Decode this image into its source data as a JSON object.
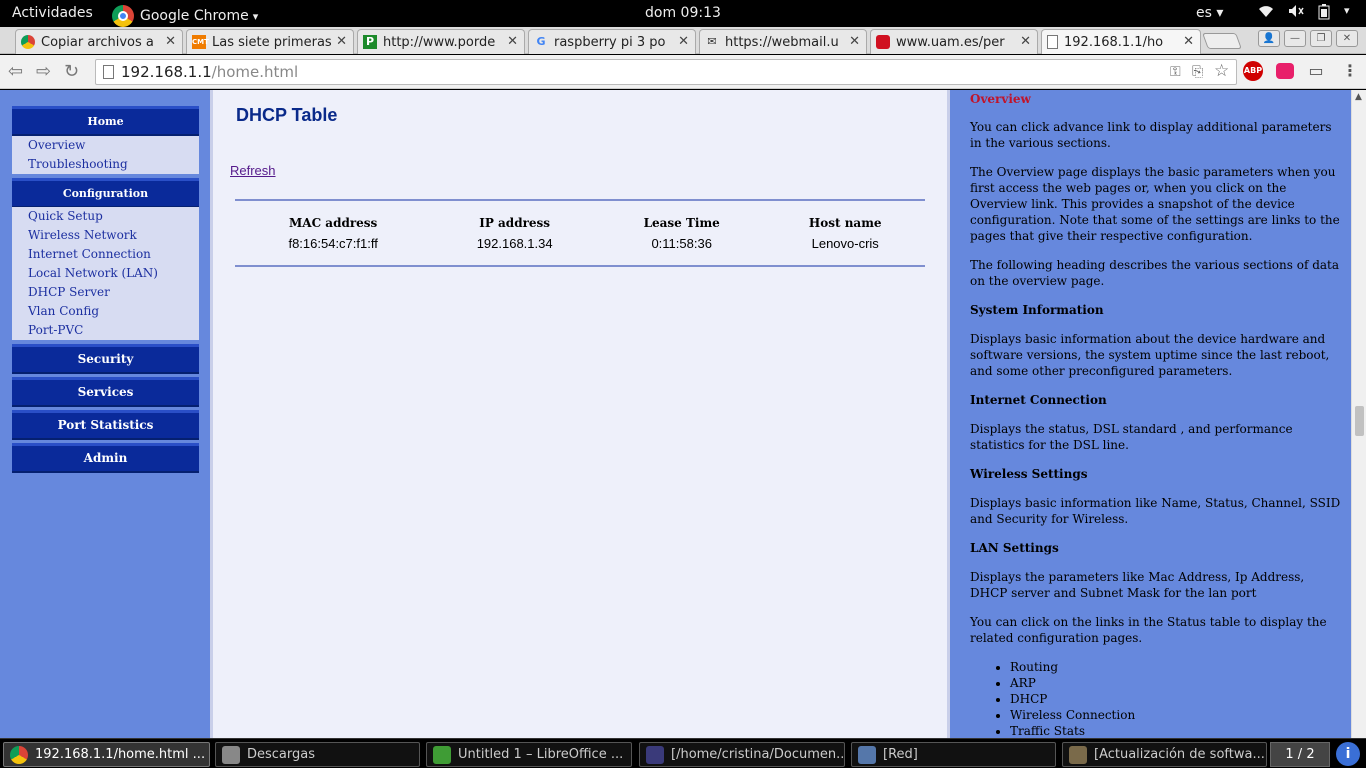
{
  "topbar": {
    "activities": "Actividades",
    "app_name": "Google Chrome",
    "app_menu_arrow": "▾",
    "clock": "dom 09:13",
    "language": "es ▾",
    "wifi_icon": "wifi-icon",
    "volume_icon": "volume-icon",
    "battery_icon": "battery-icon"
  },
  "tabs": [
    {
      "title": "Copiar archivos a",
      "icon": "chrome-icon"
    },
    {
      "title": "Las siete primeras",
      "icon": "cmt-icon"
    },
    {
      "title": "http://www.porde",
      "icon": "p-icon"
    },
    {
      "title": "raspberry pi 3 po",
      "icon": "google-icon"
    },
    {
      "title": "https://webmail.u",
      "icon": "mail-icon"
    },
    {
      "title": "www.uam.es/per",
      "icon": "uam-icon"
    },
    {
      "title": "192.168.1.1/ho",
      "icon": "page-icon",
      "active": true
    }
  ],
  "omnibox": {
    "host": "192.168.1.1",
    "path": "/home.html"
  },
  "extensions": {
    "abp_label": "ABP"
  },
  "nav": {
    "home": "Home",
    "home_items": [
      "Overview",
      "Troubleshooting"
    ],
    "configuration": "Configuration",
    "config_items": [
      "Quick Setup",
      "Wireless Network",
      "Internet Connection",
      "Local Network (LAN)",
      "DHCP Server",
      "Vlan Config",
      "Port-PVC"
    ],
    "security": "Security",
    "services": "Services",
    "port_statistics": "Port Statistics",
    "admin": "Admin"
  },
  "content": {
    "title": "DHCP Table",
    "refresh": "Refresh",
    "table": {
      "headers": [
        "MAC address",
        "IP address",
        "Lease Time",
        "Host name"
      ],
      "rows": [
        [
          "f8:16:54:c7:f1:ff",
          "192.168.1.34",
          "0:11:58:36",
          "Lenovo-cris"
        ]
      ]
    }
  },
  "help": {
    "heading": "Overview",
    "p1": "You can click advance link to display additional parameters in the various sections.",
    "p2": "The Overview page displays the basic parameters when you first access the web pages or, when you click on the Overview link. This provides a snapshot of the device configuration. Note that some of the settings are links to the pages that give their respective configuration.",
    "p3": "The following heading describes the various sections of data on the overview page.",
    "h_system": "System Information",
    "p_system": "Displays basic information about the device hardware and software versions, the system uptime since the last reboot, and some other preconfigured parameters.",
    "h_internet": "Internet Connection",
    "p_internet": "Displays the status, DSL standard , and performance statistics for the DSL line.",
    "h_wireless": "Wireless Settings",
    "p_wireless": "Displays basic information like Name, Status, Channel, SSID and Security for Wireless.",
    "h_lan": "LAN Settings",
    "p_lan": "Displays the parameters like Mac Address, Ip Address, DHCP server and Subnet Mask for the lan port",
    "p_links": "You can click on the links in the Status table to display the related configuration pages.",
    "list": [
      "Routing",
      "ARP",
      "DHCP",
      "Wireless Connection",
      "Traffic Stats"
    ]
  },
  "taskbar": {
    "tasks": [
      {
        "label": "192.168.1.1/home.html ...",
        "active": true
      },
      {
        "label": "Descargas"
      },
      {
        "label": "Untitled 1 – LibreOffice ..."
      },
      {
        "label": "[/home/cristina/Documen..."
      },
      {
        "label": "[Red]"
      },
      {
        "label": "[Actualización de softwa..."
      }
    ],
    "pager": "1 / 2",
    "info": "i"
  },
  "colors": {
    "page_bg": "#6688dd",
    "menu_header": "#0a2a9a",
    "content_bg": "#eef0fa",
    "help_heading": "#c0142a"
  }
}
